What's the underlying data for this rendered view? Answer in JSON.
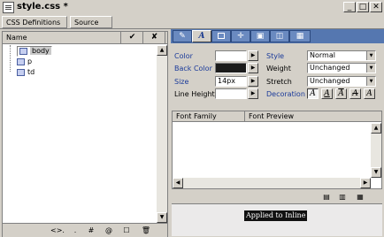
{
  "window": {
    "title": "style.css *"
  },
  "tabs": [
    {
      "label": "CSS Definitions"
    },
    {
      "label": "Source"
    }
  ],
  "help_glyph": "?",
  "tree": {
    "header": "Name",
    "check_glyph": "✔",
    "x_glyph": "✘",
    "items": [
      {
        "label": "body",
        "selected": true
      },
      {
        "label": "p",
        "selected": false
      },
      {
        "label": "td",
        "selected": false
      }
    ],
    "footer_glyphs": [
      "<>.",
      ".",
      "#",
      "@",
      "☐",
      "🗑"
    ]
  },
  "toolbar": {
    "buttons": [
      "pencil-icon",
      "font-A-icon",
      "background-icon",
      "move-icon",
      "box-icon",
      "border-icon",
      "pattern-icon"
    ],
    "active_glyph": "A"
  },
  "font": {
    "color_label": "Color",
    "back_color_label": "Back Color",
    "size_label": "Size",
    "size_value": "14px",
    "line_height_label": "Line Height",
    "style_label": "Style",
    "style_value": "Normal",
    "weight_label": "Weight",
    "weight_value": "Unchanged",
    "stretch_label": "Stretch",
    "stretch_value": "Unchanged",
    "decoration_label": "Decoration",
    "decoration_glyphs": [
      "A",
      "A",
      "A",
      "A",
      "A"
    ],
    "back_color_swatch": "#1c1c1c",
    "label_color": "#1a3a9a"
  },
  "font_panel": {
    "col1": "Font Family",
    "col2": "Font Preview"
  },
  "preview": {
    "text": "Applied to Inline"
  }
}
